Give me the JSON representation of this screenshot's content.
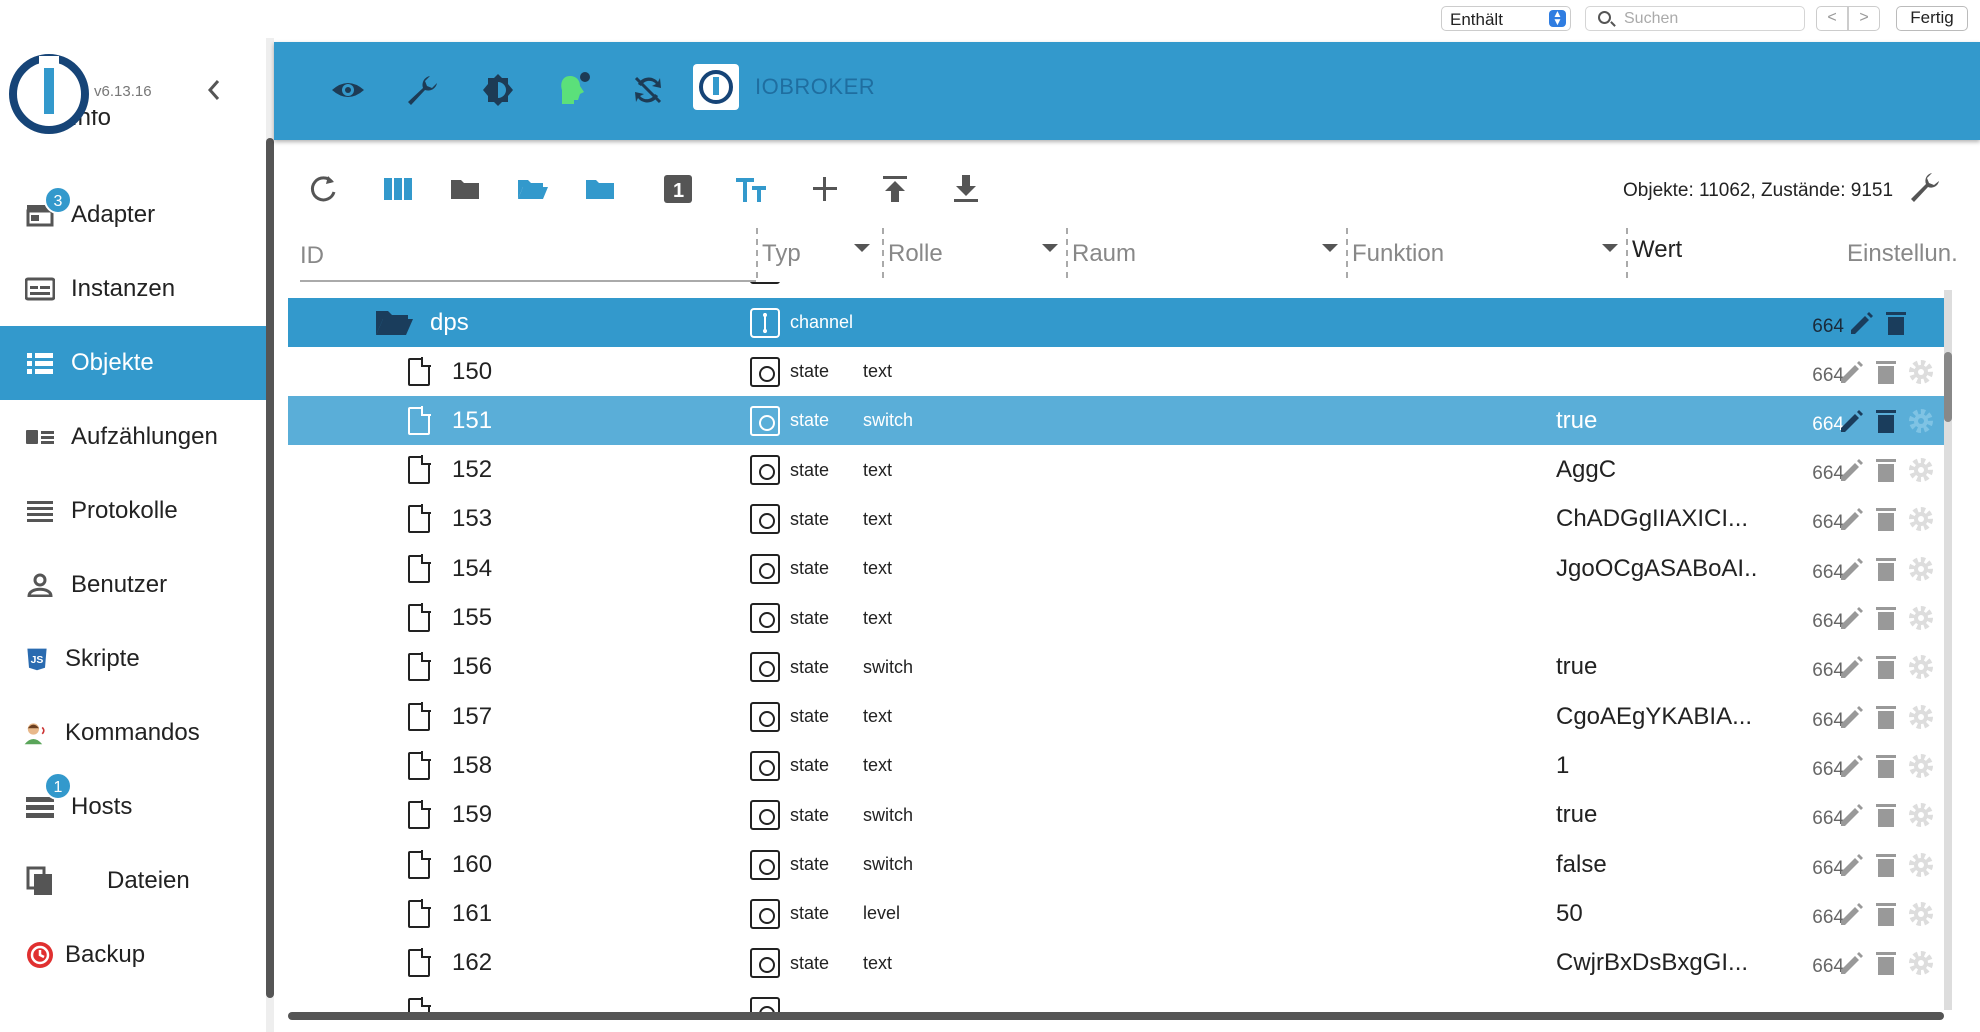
{
  "findbar": {
    "mode": "Enthält",
    "search_placeholder": "Suchen",
    "prev": "<",
    "next": ">",
    "done": "Fertig"
  },
  "sidebar": {
    "version": "v6.13.16",
    "items": [
      {
        "label": "Info",
        "icon": "info-icon"
      },
      {
        "label": "Adapter",
        "icon": "store-icon",
        "badge": "3"
      },
      {
        "label": "Instanzen",
        "icon": "instances-icon"
      },
      {
        "label": "Objekte",
        "icon": "list-icon",
        "active": true
      },
      {
        "label": "Aufzählungen",
        "icon": "enums-icon"
      },
      {
        "label": "Protokolle",
        "icon": "log-icon"
      },
      {
        "label": "Benutzer",
        "icon": "user-icon"
      },
      {
        "label": "Skripte",
        "icon": "javascript-icon"
      },
      {
        "label": "Kommandos",
        "icon": "voice-icon"
      },
      {
        "label": "Hosts",
        "icon": "hosts-icon",
        "badge": "1"
      },
      {
        "label": "Dateien",
        "icon": "files-icon"
      },
      {
        "label": "Backup",
        "icon": "backup-icon"
      }
    ]
  },
  "header": {
    "brand": "IOBROKER",
    "icons": [
      "eye-icon",
      "wrench-icon",
      "theme-icon",
      "expert-head-icon",
      "sync-icon"
    ]
  },
  "toolbar": {
    "counts": "Objekte: 11062, Zustände: 9151"
  },
  "columns": {
    "id": "ID",
    "type": "Typ",
    "role": "Rolle",
    "room": "Raum",
    "function": "Funktion",
    "value": "Wert",
    "settings": "Einstellun."
  },
  "folder_row": {
    "name": "dps",
    "type": "channel",
    "acl": "664"
  },
  "rows": [
    {
      "id": "150",
      "type": "state",
      "role": "text",
      "value": "",
      "acl": "664"
    },
    {
      "id": "151",
      "type": "state",
      "role": "switch",
      "value": "true",
      "acl": "664",
      "highlight": true
    },
    {
      "id": "152",
      "type": "state",
      "role": "text",
      "value": "AggC",
      "acl": "664"
    },
    {
      "id": "153",
      "type": "state",
      "role": "text",
      "value": "ChADGgIIAXICI...",
      "acl": "664"
    },
    {
      "id": "154",
      "type": "state",
      "role": "text",
      "value": "JgoOCgASABoAI...",
      "acl": "664"
    },
    {
      "id": "155",
      "type": "state",
      "role": "text",
      "value": "",
      "acl": "664"
    },
    {
      "id": "156",
      "type": "state",
      "role": "switch",
      "value": "true",
      "acl": "664"
    },
    {
      "id": "157",
      "type": "state",
      "role": "text",
      "value": "CgoAEgYKABIA...",
      "acl": "664"
    },
    {
      "id": "158",
      "type": "state",
      "role": "text",
      "value": "1",
      "acl": "664"
    },
    {
      "id": "159",
      "type": "state",
      "role": "switch",
      "value": "true",
      "acl": "664"
    },
    {
      "id": "160",
      "type": "state",
      "role": "switch",
      "value": "false",
      "acl": "664"
    },
    {
      "id": "161",
      "type": "state",
      "role": "level",
      "value": "50",
      "acl": "664"
    },
    {
      "id": "162",
      "type": "state",
      "role": "text",
      "value": "CwjrBxDsBxgGI...",
      "acl": "664"
    }
  ],
  "colors": {
    "primary": "#3399cc",
    "highlight": "#5aaed8",
    "logo_dark": "#164477"
  }
}
